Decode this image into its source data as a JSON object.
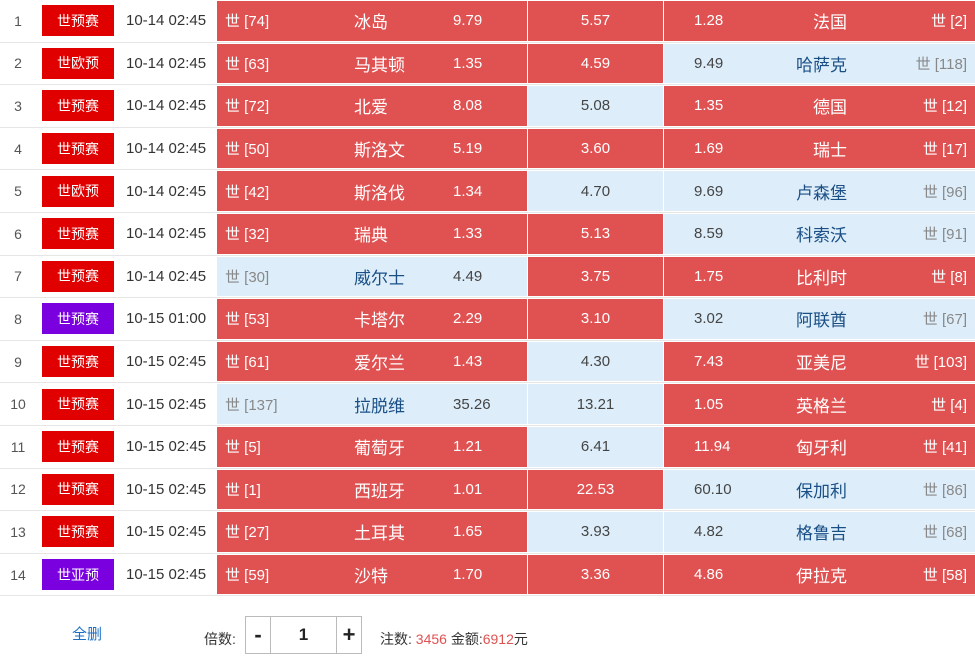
{
  "rows": [
    {
      "idx": "1",
      "league": "世预赛",
      "league_color": "red",
      "time": "10-14 02:45",
      "home_rank": "世 [74]",
      "home": "冰岛",
      "odds_home": "9.79",
      "odds_draw": "5.57",
      "odds_away": "1.28",
      "away": "法国",
      "away_rank": "世 [2]",
      "sel": [
        true,
        true,
        true
      ]
    },
    {
      "idx": "2",
      "league": "世欧预",
      "league_color": "red",
      "time": "10-14 02:45",
      "home_rank": "世 [63]",
      "home": "马其顿",
      "odds_home": "1.35",
      "odds_draw": "4.59",
      "odds_away": "9.49",
      "away": "哈萨克",
      "away_rank": "世 [118]",
      "sel": [
        true,
        true,
        false
      ]
    },
    {
      "idx": "3",
      "league": "世预赛",
      "league_color": "red",
      "time": "10-14 02:45",
      "home_rank": "世 [72]",
      "home": "北爱",
      "odds_home": "8.08",
      "odds_draw": "5.08",
      "odds_away": "1.35",
      "away": "德国",
      "away_rank": "世 [12]",
      "sel": [
        true,
        false,
        true
      ]
    },
    {
      "idx": "4",
      "league": "世预赛",
      "league_color": "red",
      "time": "10-14 02:45",
      "home_rank": "世 [50]",
      "home": "斯洛文",
      "odds_home": "5.19",
      "odds_draw": "3.60",
      "odds_away": "1.69",
      "away": "瑞士",
      "away_rank": "世 [17]",
      "sel": [
        true,
        true,
        true
      ]
    },
    {
      "idx": "5",
      "league": "世欧预",
      "league_color": "red",
      "time": "10-14 02:45",
      "home_rank": "世 [42]",
      "home": "斯洛伐",
      "odds_home": "1.34",
      "odds_draw": "4.70",
      "odds_away": "9.69",
      "away": "卢森堡",
      "away_rank": "世 [96]",
      "sel": [
        true,
        false,
        false
      ]
    },
    {
      "idx": "6",
      "league": "世预赛",
      "league_color": "red",
      "time": "10-14 02:45",
      "home_rank": "世 [32]",
      "home": "瑞典",
      "odds_home": "1.33",
      "odds_draw": "5.13",
      "odds_away": "8.59",
      "away": "科索沃",
      "away_rank": "世 [91]",
      "sel": [
        true,
        true,
        false
      ]
    },
    {
      "idx": "7",
      "league": "世预赛",
      "league_color": "red",
      "time": "10-14 02:45",
      "home_rank": "世 [30]",
      "home": "威尔士",
      "odds_home": "4.49",
      "odds_draw": "3.75",
      "odds_away": "1.75",
      "away": "比利时",
      "away_rank": "世 [8]",
      "sel": [
        false,
        true,
        true
      ]
    },
    {
      "idx": "8",
      "league": "世预赛",
      "league_color": "purple",
      "time": "10-15 01:00",
      "home_rank": "世 [53]",
      "home": "卡塔尔",
      "odds_home": "2.29",
      "odds_draw": "3.10",
      "odds_away": "3.02",
      "away": "阿联酋",
      "away_rank": "世 [67]",
      "sel": [
        true,
        true,
        false
      ]
    },
    {
      "idx": "9",
      "league": "世预赛",
      "league_color": "red",
      "time": "10-15 02:45",
      "home_rank": "世 [61]",
      "home": "爱尔兰",
      "odds_home": "1.43",
      "odds_draw": "4.30",
      "odds_away": "7.43",
      "away": "亚美尼",
      "away_rank": "世 [103]",
      "sel": [
        true,
        false,
        true
      ]
    },
    {
      "idx": "10",
      "league": "世预赛",
      "league_color": "red",
      "time": "10-15 02:45",
      "home_rank": "世 [137]",
      "home": "拉脱维",
      "odds_home": "35.26",
      "odds_draw": "13.21",
      "odds_away": "1.05",
      "away": "英格兰",
      "away_rank": "世 [4]",
      "sel": [
        false,
        false,
        true
      ]
    },
    {
      "idx": "11",
      "league": "世预赛",
      "league_color": "red",
      "time": "10-15 02:45",
      "home_rank": "世 [5]",
      "home": "葡萄牙",
      "odds_home": "1.21",
      "odds_draw": "6.41",
      "odds_away": "11.94",
      "away": "匈牙利",
      "away_rank": "世 [41]",
      "sel": [
        true,
        false,
        true
      ]
    },
    {
      "idx": "12",
      "league": "世预赛",
      "league_color": "red",
      "time": "10-15 02:45",
      "home_rank": "世 [1]",
      "home": "西班牙",
      "odds_home": "1.01",
      "odds_draw": "22.53",
      "odds_away": "60.10",
      "away": "保加利",
      "away_rank": "世 [86]",
      "sel": [
        true,
        true,
        false
      ]
    },
    {
      "idx": "13",
      "league": "世预赛",
      "league_color": "red",
      "time": "10-15 02:45",
      "home_rank": "世 [27]",
      "home": "土耳其",
      "odds_home": "1.65",
      "odds_draw": "3.93",
      "odds_away": "4.82",
      "away": "格鲁吉",
      "away_rank": "世 [68]",
      "sel": [
        true,
        false,
        false
      ]
    },
    {
      "idx": "14",
      "league": "世亚预",
      "league_color": "purple",
      "time": "10-15 02:45",
      "home_rank": "世 [59]",
      "home": "沙特",
      "odds_home": "1.70",
      "odds_draw": "3.36",
      "odds_away": "4.86",
      "away": "伊拉克",
      "away_rank": "世 [58]",
      "sel": [
        true,
        true,
        true
      ]
    }
  ],
  "footer": {
    "clear_all": "全删",
    "multiplier_label": "倍数:",
    "multiplier_value": "1",
    "minus": "-",
    "plus": "+",
    "bets_label": "注数:",
    "bets_value": "3456",
    "amount_label": "金额:",
    "amount_value": "6912",
    "amount_unit": "元"
  },
  "colors": {
    "selected": "#e05252",
    "unselected": "#ddeefa",
    "league_red": "#e00000",
    "league_purple": "#7b00e0",
    "link": "#1a6fc4"
  }
}
